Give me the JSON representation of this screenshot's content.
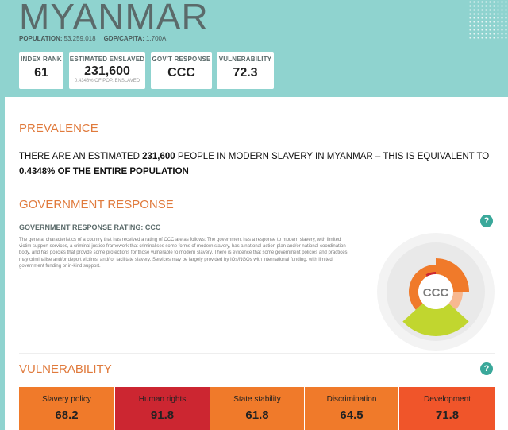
{
  "country": "MYANMAR",
  "meta": {
    "population_label": "POPULATION:",
    "population_value": "53,259,018",
    "gdp_label": "GDP/CAPITA:",
    "gdp_value": "1,700A"
  },
  "stats": [
    {
      "label": "INDEX RANK",
      "value": "61",
      "sub": ""
    },
    {
      "label": "ESTIMATED ENSLAVED",
      "value": "231,600",
      "sub": "0.4348% OF POP. ENSLAVED"
    },
    {
      "label": "GOV'T RESPONSE",
      "value": "CCC",
      "sub": ""
    },
    {
      "label": "VULNERABILITY",
      "value": "72.3",
      "sub": ""
    }
  ],
  "prevalence": {
    "heading": "PREVALENCE",
    "text_a": "THERE ARE AN ESTIMATED ",
    "number": "231,600",
    "text_b": " PEOPLE IN MODERN SLAVERY IN MYANMAR – THIS IS EQUIVALENT TO",
    "percent": "0.4348%",
    "text_c": " OF THE ENTIRE POPULATION"
  },
  "government": {
    "heading": "GOVERNMENT RESPONSE",
    "rating_line": "GOVERNMENT RESPONSE RATING: CCC",
    "description": "The general characteristics of a country that has received a rating of CCC are as follows: The government has a response to modern slavery, with limited victim support services, a criminal justice framework that criminalises some forms of modern slavery, has a national action plan and/or national coordination body, and has policies that provide some protections for those vulnerable to modern slavery. There is evidence that some government policies and practices may criminalise and/or deport victims, and/ or facilitate slavery. Services may be largely provided by IOs/NGOs with international funding, with limited government funding or in-kind support.",
    "gauge_label": "CCC",
    "help": "?"
  },
  "vulnerability": {
    "heading": "VULNERABILITY",
    "help": "?",
    "items": [
      {
        "label": "Slavery policy",
        "value": "68.2",
        "color": "#f07a2a"
      },
      {
        "label": "Human rights",
        "value": "91.8",
        "color": "#cc2631"
      },
      {
        "label": "State stability",
        "value": "61.8",
        "color": "#f07a2a"
      },
      {
        "label": "Discrimination",
        "value": "64.5",
        "color": "#f07a2a"
      },
      {
        "label": "Development",
        "value": "71.8",
        "color": "#f0552a"
      }
    ]
  },
  "colors": {
    "accent": "#e07a3c",
    "header_bg": "#8fd3cf",
    "help_bg": "#3aa89a",
    "gauge_orange": "#f07a2a",
    "gauge_green": "#c1d62f"
  }
}
